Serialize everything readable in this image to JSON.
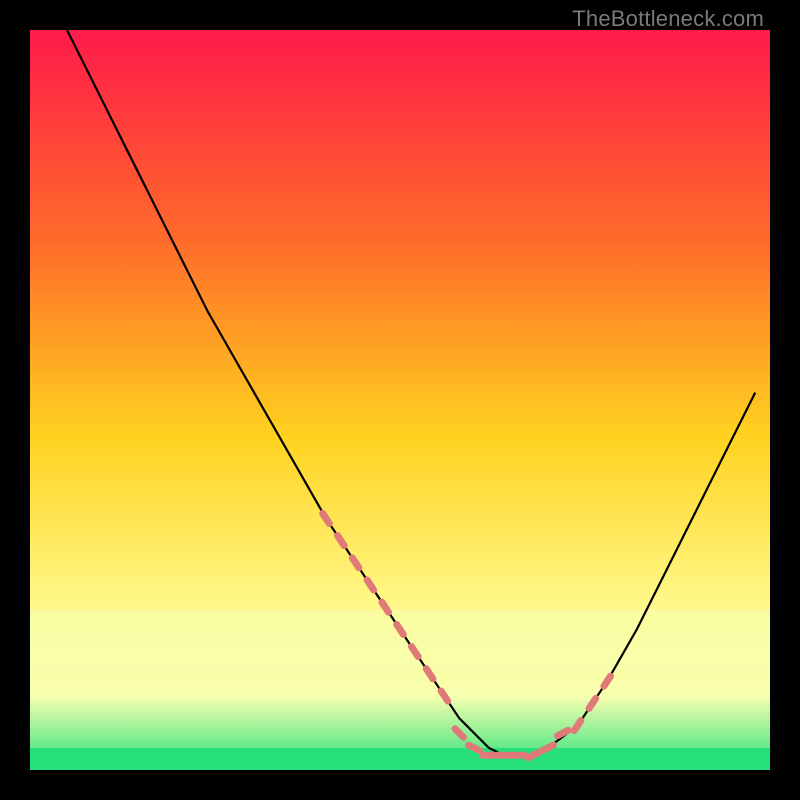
{
  "watermark": "TheBottleneck.com",
  "colors": {
    "bg": "#000000",
    "gradient_top": "#ff1a4a",
    "gradient_mid1": "#ff6a2a",
    "gradient_mid2": "#ffd21f",
    "gradient_low": "#fff98a",
    "gradient_band": "#f7ffb0",
    "gradient_bottom": "#27e07a",
    "curve": "#000000",
    "marker": "#e07a78"
  },
  "chart_data": {
    "type": "line",
    "title": "",
    "xlabel": "",
    "ylabel": "",
    "xlim": [
      0,
      100
    ],
    "ylim": [
      0,
      100
    ],
    "grid": false,
    "legend": false,
    "series": [
      {
        "name": "bottleneck_curve",
        "x": [
          5,
          8,
          12,
          16,
          20,
          24,
          28,
          32,
          36,
          40,
          44,
          48,
          50,
          52,
          54,
          56,
          58,
          60,
          62,
          64,
          66,
          68,
          70,
          74,
          78,
          82,
          86,
          90,
          94,
          98
        ],
        "y": [
          100,
          94,
          86,
          78,
          70,
          62,
          55,
          48,
          41,
          34,
          28,
          22,
          19,
          16,
          13,
          10,
          7,
          5,
          3,
          2,
          2,
          2,
          3,
          6,
          12,
          19,
          27,
          35,
          43,
          51
        ]
      }
    ],
    "highlighted_segments": [
      {
        "name": "left_descent_markers",
        "x": [
          40,
          42,
          44,
          46,
          48,
          50,
          52,
          54,
          56
        ],
        "y": [
          34,
          31,
          28,
          25,
          22,
          19,
          16,
          13,
          10
        ]
      },
      {
        "name": "valley_markers",
        "x": [
          58,
          60,
          62,
          64,
          66,
          68,
          70
        ],
        "y": [
          5,
          3,
          2,
          2,
          2,
          2,
          3
        ]
      },
      {
        "name": "right_ascent_markers",
        "x": [
          72,
          74,
          76,
          78
        ],
        "y": [
          5,
          6,
          9,
          12
        ]
      }
    ]
  }
}
